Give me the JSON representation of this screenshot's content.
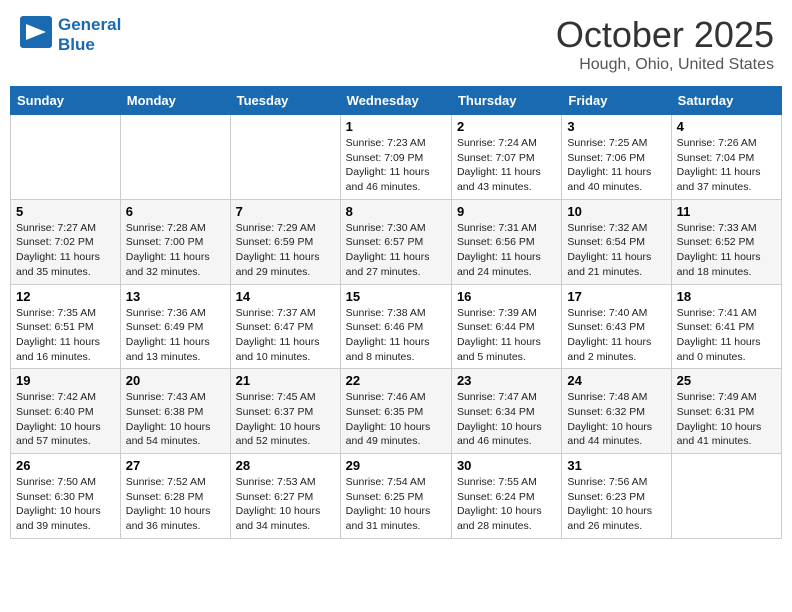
{
  "header": {
    "logo_line1": "General",
    "logo_line2": "Blue",
    "month": "October 2025",
    "location": "Hough, Ohio, United States"
  },
  "weekdays": [
    "Sunday",
    "Monday",
    "Tuesday",
    "Wednesday",
    "Thursday",
    "Friday",
    "Saturday"
  ],
  "weeks": [
    [
      {
        "day": "",
        "info": ""
      },
      {
        "day": "",
        "info": ""
      },
      {
        "day": "",
        "info": ""
      },
      {
        "day": "1",
        "info": "Sunrise: 7:23 AM\nSunset: 7:09 PM\nDaylight: 11 hours and 46 minutes."
      },
      {
        "day": "2",
        "info": "Sunrise: 7:24 AM\nSunset: 7:07 PM\nDaylight: 11 hours and 43 minutes."
      },
      {
        "day": "3",
        "info": "Sunrise: 7:25 AM\nSunset: 7:06 PM\nDaylight: 11 hours and 40 minutes."
      },
      {
        "day": "4",
        "info": "Sunrise: 7:26 AM\nSunset: 7:04 PM\nDaylight: 11 hours and 37 minutes."
      }
    ],
    [
      {
        "day": "5",
        "info": "Sunrise: 7:27 AM\nSunset: 7:02 PM\nDaylight: 11 hours and 35 minutes."
      },
      {
        "day": "6",
        "info": "Sunrise: 7:28 AM\nSunset: 7:00 PM\nDaylight: 11 hours and 32 minutes."
      },
      {
        "day": "7",
        "info": "Sunrise: 7:29 AM\nSunset: 6:59 PM\nDaylight: 11 hours and 29 minutes."
      },
      {
        "day": "8",
        "info": "Sunrise: 7:30 AM\nSunset: 6:57 PM\nDaylight: 11 hours and 27 minutes."
      },
      {
        "day": "9",
        "info": "Sunrise: 7:31 AM\nSunset: 6:56 PM\nDaylight: 11 hours and 24 minutes."
      },
      {
        "day": "10",
        "info": "Sunrise: 7:32 AM\nSunset: 6:54 PM\nDaylight: 11 hours and 21 minutes."
      },
      {
        "day": "11",
        "info": "Sunrise: 7:33 AM\nSunset: 6:52 PM\nDaylight: 11 hours and 18 minutes."
      }
    ],
    [
      {
        "day": "12",
        "info": "Sunrise: 7:35 AM\nSunset: 6:51 PM\nDaylight: 11 hours and 16 minutes."
      },
      {
        "day": "13",
        "info": "Sunrise: 7:36 AM\nSunset: 6:49 PM\nDaylight: 11 hours and 13 minutes."
      },
      {
        "day": "14",
        "info": "Sunrise: 7:37 AM\nSunset: 6:47 PM\nDaylight: 11 hours and 10 minutes."
      },
      {
        "day": "15",
        "info": "Sunrise: 7:38 AM\nSunset: 6:46 PM\nDaylight: 11 hours and 8 minutes."
      },
      {
        "day": "16",
        "info": "Sunrise: 7:39 AM\nSunset: 6:44 PM\nDaylight: 11 hours and 5 minutes."
      },
      {
        "day": "17",
        "info": "Sunrise: 7:40 AM\nSunset: 6:43 PM\nDaylight: 11 hours and 2 minutes."
      },
      {
        "day": "18",
        "info": "Sunrise: 7:41 AM\nSunset: 6:41 PM\nDaylight: 11 hours and 0 minutes."
      }
    ],
    [
      {
        "day": "19",
        "info": "Sunrise: 7:42 AM\nSunset: 6:40 PM\nDaylight: 10 hours and 57 minutes."
      },
      {
        "day": "20",
        "info": "Sunrise: 7:43 AM\nSunset: 6:38 PM\nDaylight: 10 hours and 54 minutes."
      },
      {
        "day": "21",
        "info": "Sunrise: 7:45 AM\nSunset: 6:37 PM\nDaylight: 10 hours and 52 minutes."
      },
      {
        "day": "22",
        "info": "Sunrise: 7:46 AM\nSunset: 6:35 PM\nDaylight: 10 hours and 49 minutes."
      },
      {
        "day": "23",
        "info": "Sunrise: 7:47 AM\nSunset: 6:34 PM\nDaylight: 10 hours and 46 minutes."
      },
      {
        "day": "24",
        "info": "Sunrise: 7:48 AM\nSunset: 6:32 PM\nDaylight: 10 hours and 44 minutes."
      },
      {
        "day": "25",
        "info": "Sunrise: 7:49 AM\nSunset: 6:31 PM\nDaylight: 10 hours and 41 minutes."
      }
    ],
    [
      {
        "day": "26",
        "info": "Sunrise: 7:50 AM\nSunset: 6:30 PM\nDaylight: 10 hours and 39 minutes."
      },
      {
        "day": "27",
        "info": "Sunrise: 7:52 AM\nSunset: 6:28 PM\nDaylight: 10 hours and 36 minutes."
      },
      {
        "day": "28",
        "info": "Sunrise: 7:53 AM\nSunset: 6:27 PM\nDaylight: 10 hours and 34 minutes."
      },
      {
        "day": "29",
        "info": "Sunrise: 7:54 AM\nSunset: 6:25 PM\nDaylight: 10 hours and 31 minutes."
      },
      {
        "day": "30",
        "info": "Sunrise: 7:55 AM\nSunset: 6:24 PM\nDaylight: 10 hours and 28 minutes."
      },
      {
        "day": "31",
        "info": "Sunrise: 7:56 AM\nSunset: 6:23 PM\nDaylight: 10 hours and 26 minutes."
      },
      {
        "day": "",
        "info": ""
      }
    ]
  ]
}
